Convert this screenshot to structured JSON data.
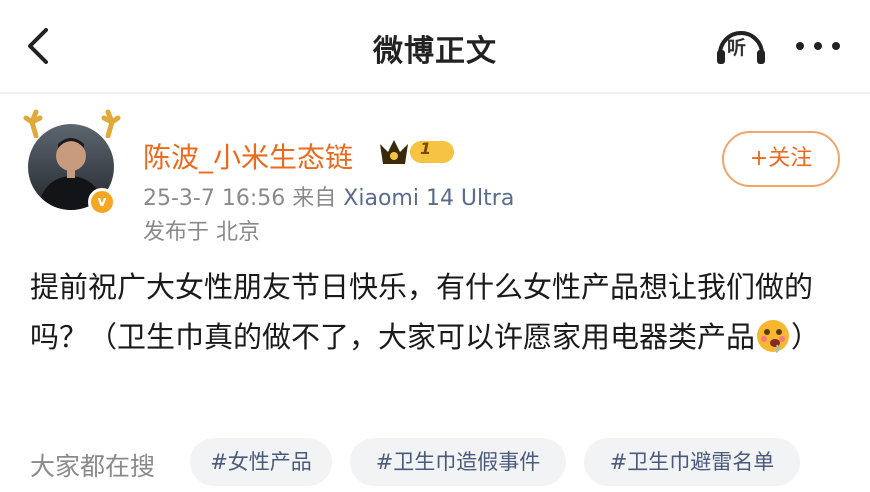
{
  "nav": {
    "title": "微博正文",
    "listen_label": "听"
  },
  "author": {
    "name": "陈波_小米生态链",
    "vip_level": "1",
    "time": "25-3-7 16:56",
    "source_prefix": "来自",
    "source": "Xiaomi 14 Ultra",
    "location": "发布于 北京",
    "follow_label": "+关注"
  },
  "post": {
    "text_before_emoji": "提前祝广大女性朋友节日快乐，有什么女性产品想让我们做的吗？（卫生巾真的做不了，大家可以许愿家用电器类产品",
    "text_after_emoji": "）"
  },
  "search": {
    "label": "大家都在搜",
    "tags": [
      "#女性产品",
      "#卫生巾造假事件",
      "#卫生巾避雷名单"
    ]
  },
  "colors": {
    "username": "#ea6b1e",
    "follow_border": "#f3a46b",
    "tag_bg": "#f2f3f5",
    "tag_text": "#4a5a7a",
    "verify_badge": "#f5a623"
  }
}
